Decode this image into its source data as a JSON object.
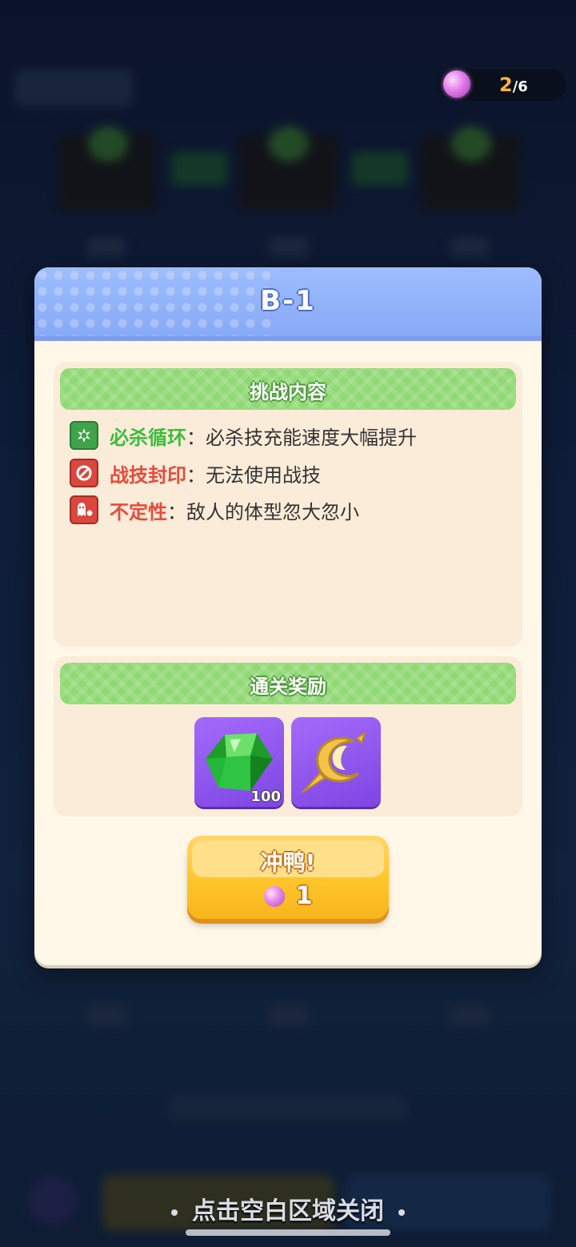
{
  "energy": {
    "current": "2",
    "separator": "/",
    "max": "6",
    "icon": "energy-orb-icon"
  },
  "modal": {
    "title": "B-1",
    "challenge": {
      "heading": "挑战内容",
      "rules": [
        {
          "name": "必杀循环",
          "sep": "：",
          "desc": "必杀技充能速度大幅提升",
          "icon": "ultimate-cycle-icon",
          "color": "#3bbd3c"
        },
        {
          "name": "战技封印",
          "sep": "：",
          "desc": "无法使用战技",
          "icon": "skill-seal-icon",
          "color": "#e84a3a"
        },
        {
          "name": "不定性",
          "sep": "：",
          "desc": "敌人的体型忽大忽小",
          "icon": "instability-icon",
          "color": "#e84a3a"
        }
      ]
    },
    "rewards": {
      "heading": "通关奖励",
      "items": [
        {
          "icon": "green-gem-icon",
          "count": "100"
        },
        {
          "icon": "golden-crescent-icon",
          "count": ""
        }
      ]
    },
    "go_button": {
      "label": "冲鸭!",
      "cost": "1",
      "cost_icon": "energy-orb-icon"
    }
  },
  "close_hint": "点击空白区域关闭",
  "colors": {
    "header": "#88a9f6",
    "section_bar": "#8fd873",
    "button": "#ffc72c",
    "modal_bg": "#fff8e8"
  }
}
